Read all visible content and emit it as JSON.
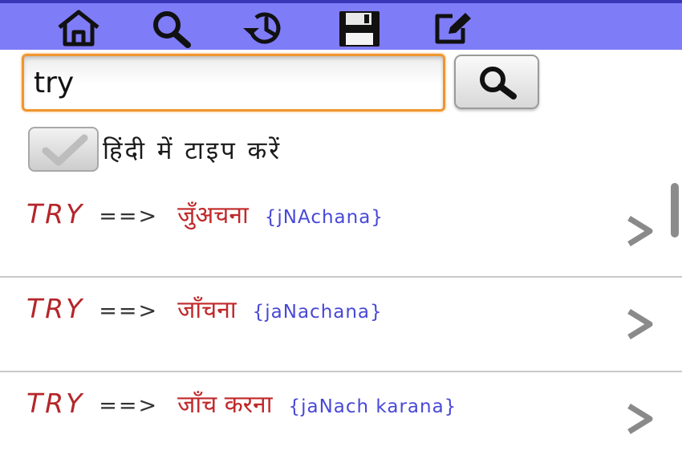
{
  "toolbar": {
    "icons": [
      "home-icon",
      "search-icon",
      "history-icon",
      "save-icon",
      "edit-icon"
    ],
    "background_color": "#7f7cf8"
  },
  "search": {
    "query": "try",
    "button_icon": "search-icon",
    "focus_color": "#f0962e"
  },
  "hindi_typing": {
    "checked": true,
    "label": "हिंदी में टाइप करें"
  },
  "results": [
    {
      "english": "TRY",
      "arrow": "==>",
      "hindi": "जुँअचना",
      "translit": "{jNAchana}"
    },
    {
      "english": "TRY",
      "arrow": "==>",
      "hindi": "जाँचना",
      "translit": "{jaNachana}"
    },
    {
      "english": "TRY",
      "arrow": "==>",
      "hindi": "जाँच करना",
      "translit": "{jaNach karana}"
    }
  ],
  "colors": {
    "english_word": "#b4262a",
    "hindi_word": "#c0282a",
    "transliteration": "#4848d8"
  }
}
